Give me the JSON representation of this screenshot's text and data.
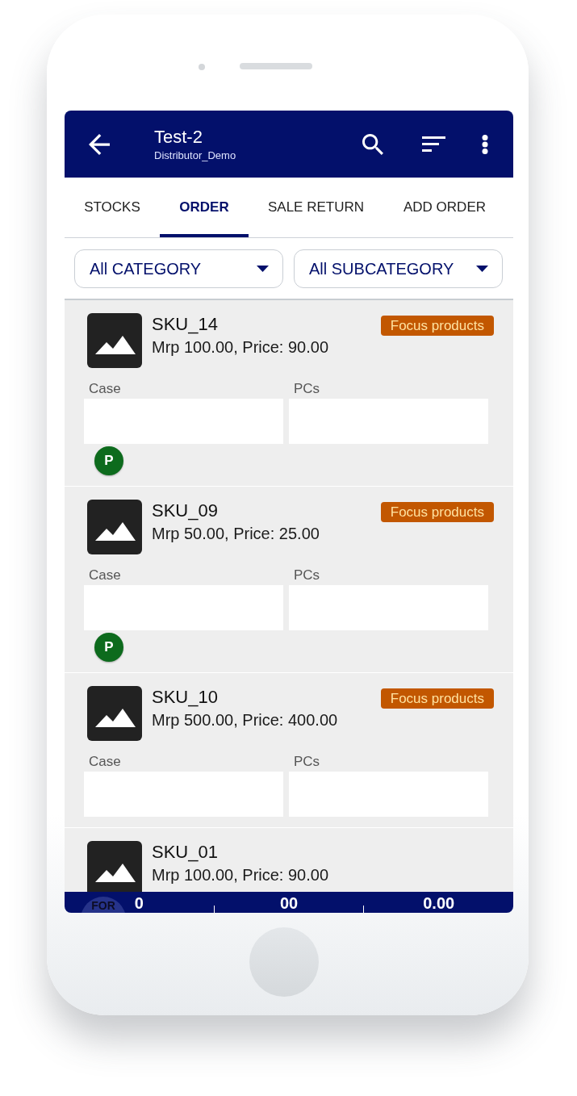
{
  "app_bar": {
    "title": "Test-2",
    "subtitle": "Distributor_Demo"
  },
  "tabs": [
    {
      "label": "STOCKS",
      "selected": false
    },
    {
      "label": "ORDER",
      "selected": true
    },
    {
      "label": "SALE RETURN",
      "selected": false
    },
    {
      "label": "ADD ORDER",
      "selected": false
    }
  ],
  "filters": [
    {
      "value": "All CATEGORY"
    },
    {
      "value": "All SUBCATEGORY"
    }
  ],
  "products": [
    {
      "name": "SKU_14",
      "price_line": "Mrp 100.00, Price: 90.00",
      "badge": "Focus products",
      "fields": [
        {
          "label": "Case"
        },
        {
          "label": "PCs"
        }
      ],
      "tag": "P"
    },
    {
      "name": "SKU_09",
      "price_line": "Mrp 50.00, Price: 25.00",
      "badge": "Focus products",
      "fields": [
        {
          "label": "Case"
        },
        {
          "label": "PCs"
        }
      ],
      "tag": "P"
    },
    {
      "name": "SKU_10",
      "price_line": "Mrp 500.00, Price: 400.00",
      "badge": "Focus products",
      "fields": [
        {
          "label": "Case"
        },
        {
          "label": "PCs"
        }
      ]
    },
    {
      "name": "SKU_01",
      "price_line": "Mrp 100.00, Price: 90.00"
    }
  ],
  "floating_button": {
    "label": "FOR"
  },
  "totals": [
    "0",
    "00",
    "0.00"
  ]
}
